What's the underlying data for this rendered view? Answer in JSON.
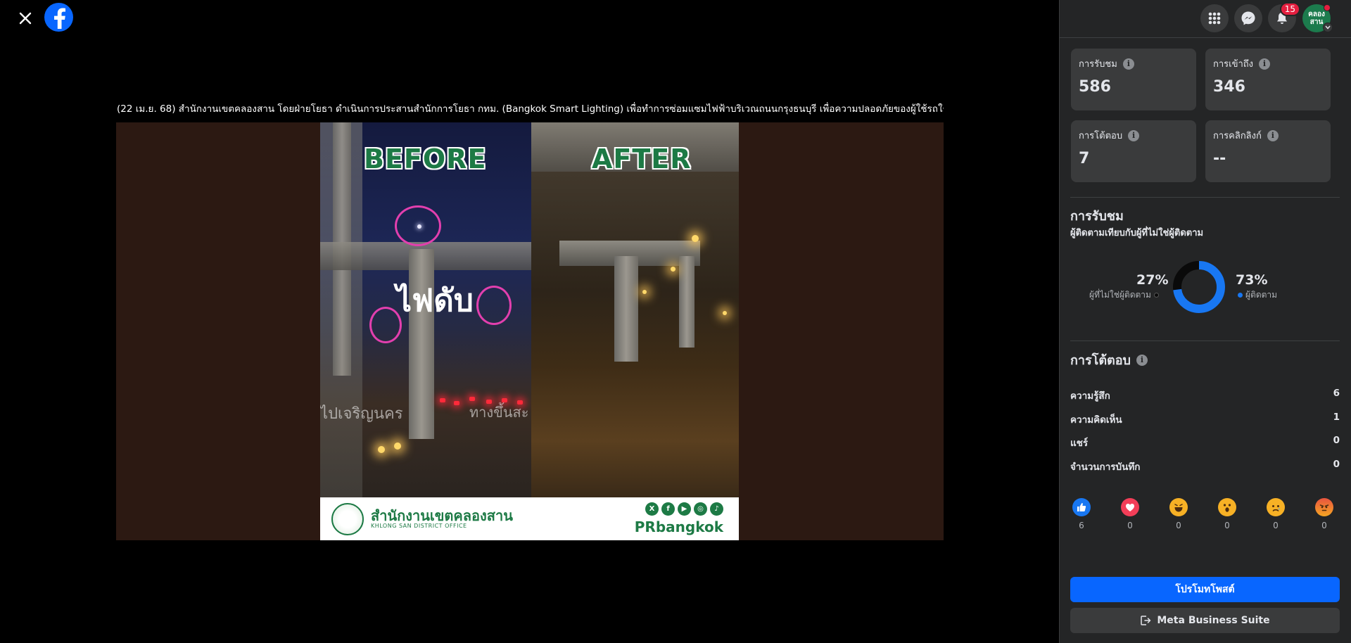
{
  "viewer": {
    "caption": "(22 เม.ย. 68) สำนักงานเขตคลองสาน โดยฝ่ายโยธา ดำเนินการประสานสำนักการโยธา กทม. (Bangkok Smart Lighting) เพื่อทำการซ่อมแซมไฟฟ้าบริเวณถนนกรุงธนบุรี เพื่อความปลอดภัยของผู้ใช้รถใช้ถนน",
    "image": {
      "before_label": "BEFORE",
      "after_label": "AFTER",
      "lights_out_text": "ไฟดับ",
      "sign_left": "ไปเจริญนคร",
      "sign_right": "ทางขึ้นสะ",
      "office_name_th": "สำนักงานเขตคลองสาน",
      "office_name_en": "KHLONG SAN DISTRICT OFFICE",
      "social_handle": "PRbangkok"
    }
  },
  "topbar": {
    "notification_count": "15",
    "avatar_text_line1": "คลอง",
    "avatar_text_line2": "สาน"
  },
  "stats": [
    {
      "label": "การรับชม",
      "value": "586"
    },
    {
      "label": "การเข้าถึง",
      "value": "346"
    },
    {
      "label": "การโต้ตอบ",
      "value": "7"
    },
    {
      "label": "การคลิกลิงก์",
      "value": "--"
    }
  ],
  "views_section": {
    "title": "การรับชม",
    "subtitle": "ผู้ติดตามเทียบกับผู้ที่ไม่ใช่ผู้ติดตาม",
    "non_followers_pct": "27%",
    "non_followers_label": "ผู้ที่ไม่ใช่ผู้ติดตาม",
    "followers_pct": "73%",
    "followers_label": "ผู้ติดตาม",
    "followers_fraction": 0.73,
    "followers_color": "#1877f2",
    "non_followers_color": "#0a0a0a"
  },
  "interactions_section": {
    "title": "การโต้ตอบ",
    "rows": [
      {
        "label": "ความรู้สึก",
        "value": "6"
      },
      {
        "label": "ความคิดเห็น",
        "value": "1"
      },
      {
        "label": "แชร์",
        "value": "0"
      },
      {
        "label": "จำนวนการบันทึก",
        "value": "0"
      }
    ],
    "reactions": [
      {
        "name": "like",
        "count": "6"
      },
      {
        "name": "love",
        "count": "0"
      },
      {
        "name": "haha",
        "count": "0"
      },
      {
        "name": "wow",
        "count": "0"
      },
      {
        "name": "sad",
        "count": "0"
      },
      {
        "name": "angry",
        "count": "0"
      }
    ]
  },
  "actions": {
    "promote_label": "โปรโมทโพสต์",
    "business_suite_label": "Meta Business Suite"
  }
}
